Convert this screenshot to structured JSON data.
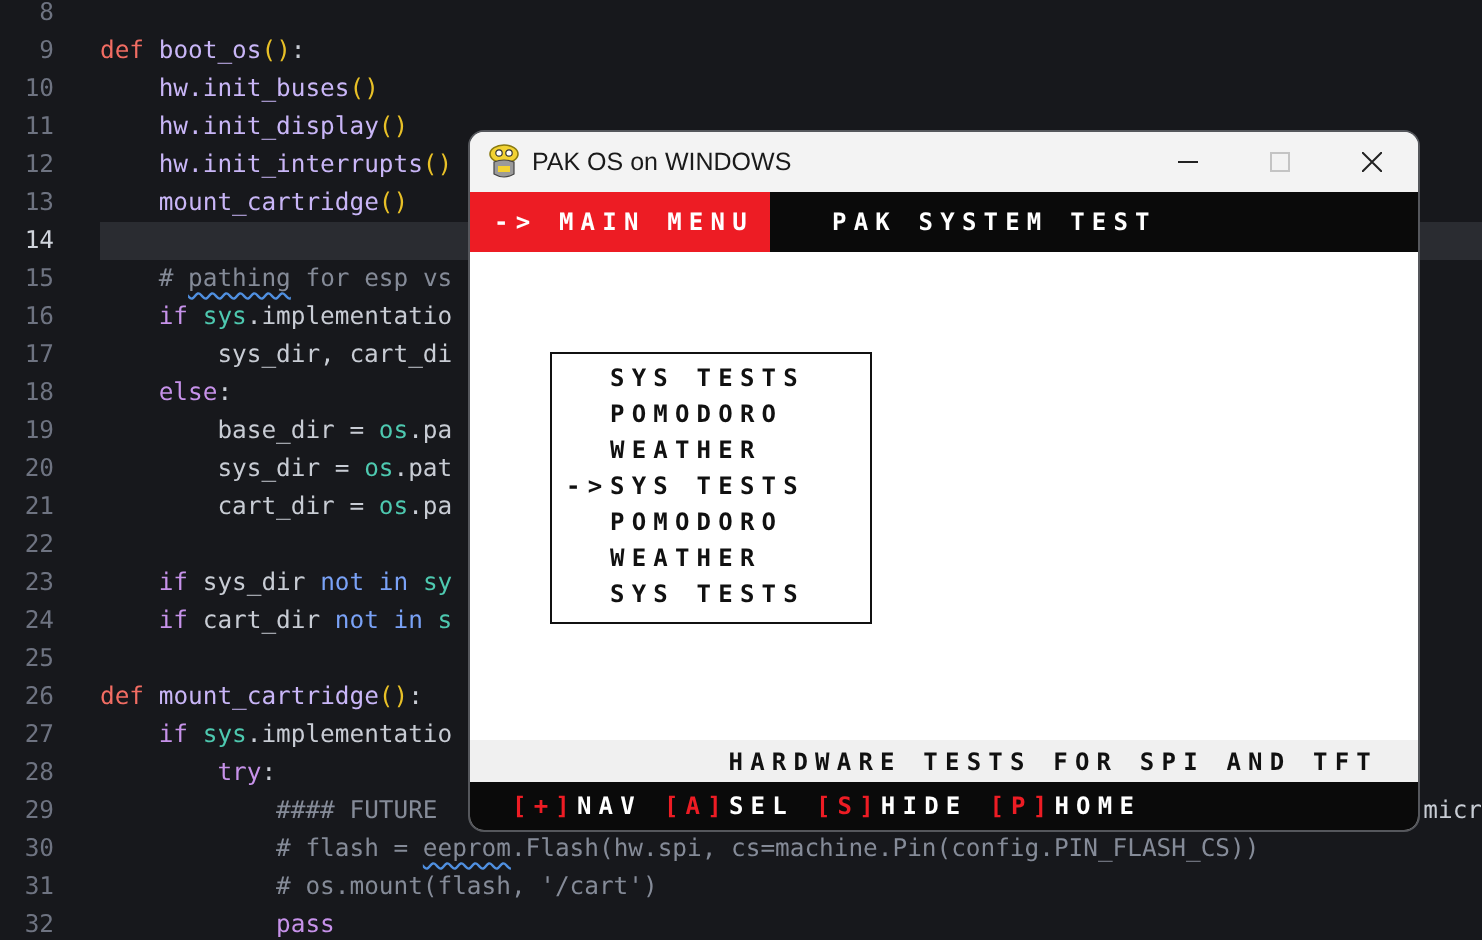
{
  "editor": {
    "lines": [
      {
        "number": "8",
        "current": false
      },
      {
        "number": "9",
        "current": false,
        "tokens": [
          {
            "kind": "def",
            "text": "def "
          },
          {
            "kind": "func",
            "text": "boot_os"
          },
          {
            "kind": "paren",
            "text": "()"
          },
          {
            "kind": "plain",
            "text": ":"
          }
        ],
        "children": [
          {
            "number": "10",
            "current": false,
            "tokens": [
              {
                "kind": "func",
                "text": "hw.init_buses"
              },
              {
                "kind": "paren",
                "text": "()"
              }
            ]
          },
          {
            "number": "11",
            "current": false,
            "tokens": [
              {
                "kind": "func",
                "text": "hw.init_display"
              },
              {
                "kind": "paren",
                "text": "()"
              }
            ]
          },
          {
            "number": "12",
            "current": false,
            "tokens": [
              {
                "kind": "func",
                "text": "hw.init_interrupts"
              },
              {
                "kind": "paren",
                "text": "()"
              }
            ]
          },
          {
            "number": "13",
            "current": false,
            "tokens": [
              {
                "kind": "func",
                "text": "mount_cartridge"
              },
              {
                "kind": "paren",
                "text": "()"
              }
            ]
          },
          {
            "number": "14",
            "current": true
          },
          {
            "number": "15",
            "current": false,
            "tokens": [
              {
                "kind": "comment",
                "text": "# "
              },
              {
                "kind": "comment",
                "text": "pathing",
                "squiggle": true
              },
              {
                "kind": "comment",
                "text": " for esp vs"
              }
            ]
          },
          {
            "number": "16",
            "current": false,
            "tokens": [
              {
                "kind": "keyword",
                "text": "if "
              },
              {
                "kind": "module",
                "text": "sys"
              },
              {
                "kind": "plain",
                "text": ".implementatio"
              }
            ],
            "children": [
              {
                "number": "17",
                "current": false,
                "tokens": [
                  {
                    "kind": "plain",
                    "text": "sys_dir, cart_di"
                  }
                ]
              }
            ]
          },
          {
            "number": "18",
            "current": false,
            "tokens": [
              {
                "kind": "keyword",
                "text": "else"
              },
              {
                "kind": "plain",
                "text": ":"
              }
            ],
            "children": [
              {
                "number": "19",
                "current": false,
                "tokens": [
                  {
                    "kind": "plain",
                    "text": "base_dir = "
                  },
                  {
                    "kind": "module",
                    "text": "os"
                  },
                  {
                    "kind": "plain",
                    "text": ".pa"
                  }
                ]
              },
              {
                "number": "20",
                "current": false,
                "tokens": [
                  {
                    "kind": "plain",
                    "text": "sys_dir = "
                  },
                  {
                    "kind": "module",
                    "text": "os"
                  },
                  {
                    "kind": "plain",
                    "text": ".pat"
                  }
                ]
              },
              {
                "number": "21",
                "current": false,
                "tokens": [
                  {
                    "kind": "plain",
                    "text": "cart_dir = "
                  },
                  {
                    "kind": "module",
                    "text": "os"
                  },
                  {
                    "kind": "plain",
                    "text": ".pa"
                  }
                ]
              }
            ]
          },
          {
            "number": "22",
            "current": false
          },
          {
            "number": "23",
            "current": false,
            "tokens": [
              {
                "kind": "keyword",
                "text": "if "
              },
              {
                "kind": "plain",
                "text": "sys_dir "
              },
              {
                "kind": "operator",
                "text": "not in "
              },
              {
                "kind": "module",
                "text": "sy"
              }
            ]
          },
          {
            "number": "24",
            "current": false,
            "tokens": [
              {
                "kind": "keyword",
                "text": "if "
              },
              {
                "kind": "plain",
                "text": "cart_dir "
              },
              {
                "kind": "operator",
                "text": "not in "
              },
              {
                "kind": "module",
                "text": "s"
              }
            ]
          }
        ]
      },
      {
        "number": "25",
        "current": false
      },
      {
        "number": "26",
        "current": false,
        "tokens": [
          {
            "kind": "def",
            "text": "def "
          },
          {
            "kind": "func",
            "text": "mount_cartridge"
          },
          {
            "kind": "paren",
            "text": "()"
          },
          {
            "kind": "plain",
            "text": ":"
          }
        ],
        "children": [
          {
            "number": "27",
            "current": false,
            "tokens": [
              {
                "kind": "keyword",
                "text": "if "
              },
              {
                "kind": "module",
                "text": "sys"
              },
              {
                "kind": "plain",
                "text": ".implementatio"
              }
            ],
            "children": [
              {
                "number": "28",
                "current": false,
                "tokens": [
                  {
                    "kind": "keyword",
                    "text": "try"
                  },
                  {
                    "kind": "plain",
                    "text": ":"
                  }
                ],
                "children": [
                  {
                    "number": "29",
                    "current": false,
                    "tokens": [
                      {
                        "kind": "comment",
                        "text": "#### FUTURE"
                      }
                    ],
                    "tail": "micr"
                  },
                  {
                    "number": "30",
                    "current": false,
                    "tokens": [
                      {
                        "kind": "comment",
                        "text": "# flash = "
                      },
                      {
                        "kind": "comment",
                        "text": "eeprom",
                        "squiggle": true
                      },
                      {
                        "kind": "comment",
                        "text": ".Flash(hw.spi, cs=machine.Pin(config.PIN_FLASH_CS))"
                      }
                    ]
                  },
                  {
                    "number": "31",
                    "current": false,
                    "tokens": [
                      {
                        "kind": "comment",
                        "text": "# os.mount(flash, '/cart')"
                      }
                    ]
                  },
                  {
                    "number": "32",
                    "current": false,
                    "tokens": [
                      {
                        "kind": "keyword",
                        "text": "pass"
                      }
                    ]
                  }
                ]
              }
            ]
          }
        ]
      }
    ]
  },
  "window": {
    "title": "PAK OS on WINDOWS",
    "buttons": [
      {
        "kind": "minimize",
        "disabled": false
      },
      {
        "kind": "maximize",
        "disabled": true
      },
      {
        "kind": "close",
        "disabled": false
      }
    ],
    "header": {
      "menu_label": "-> MAIN MENU",
      "app_title": "PAK SYSTEM TEST"
    },
    "menu": {
      "cursor": "->",
      "items": [
        {
          "label": "SYS TESTS",
          "selected": false
        },
        {
          "label": "POMODORO",
          "selected": false
        },
        {
          "label": "WEATHER",
          "selected": false
        },
        {
          "label": "SYS TESTS",
          "selected": true
        },
        {
          "label": "POMODORO",
          "selected": false
        },
        {
          "label": "WEATHER",
          "selected": false
        },
        {
          "label": "SYS TESTS",
          "selected": false
        }
      ]
    },
    "status_text": "HARDWARE TESTS FOR SPI AND TFT",
    "controls": [
      {
        "key": "[+]",
        "label": "NAV"
      },
      {
        "key": "[A]",
        "label": "SEL"
      },
      {
        "key": "[S]",
        "label": "HIDE"
      },
      {
        "key": "[P]",
        "label": "HOME"
      }
    ]
  }
}
